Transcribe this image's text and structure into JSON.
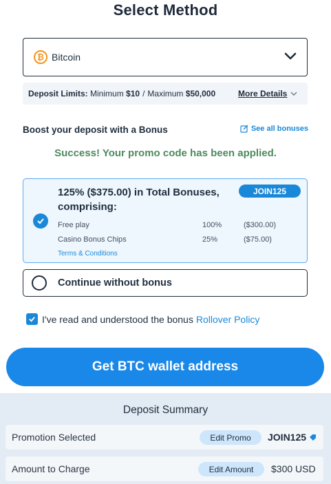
{
  "title": "Select Method",
  "method": {
    "selected": "Bitcoin",
    "icon": "bitcoin-icon",
    "icon_glyph": "₿"
  },
  "limits": {
    "label": "Deposit Limits:",
    "min_label": "Minimum",
    "min_value": "$10",
    "separator": "/",
    "max_label": "Maximum",
    "max_value": "$50,000",
    "more_details": "More Details"
  },
  "bonus": {
    "section_title": "Boost your deposit with a Bonus",
    "see_all": "See all bonuses",
    "success_message": "Success! Your promo code has been applied.",
    "card": {
      "headline": "125% ($375.00) in Total Bonuses, comprising:",
      "promo_code": "JOIN125",
      "rows": [
        {
          "name": "Free play",
          "percent": "100%",
          "amount": "($300.00)"
        },
        {
          "name": "Casino Bonus Chips",
          "percent": "25%",
          "amount": "($75.00)"
        }
      ],
      "terms": "Terms & Conditions"
    },
    "no_bonus_label": "Continue without bonus"
  },
  "acknowledge": {
    "text": "I've read and understood the bonus",
    "link": "Rollover Policy"
  },
  "cta": {
    "label": "Get BTC wallet address"
  },
  "summary": {
    "title": "Deposit Summary",
    "promotion": {
      "label": "Promotion Selected",
      "edit": "Edit Promo",
      "value": "JOIN125"
    },
    "amount": {
      "label": "Amount to Charge",
      "edit": "Edit Amount",
      "value": "$300 USD"
    }
  },
  "colors": {
    "accent": "#1a88e8",
    "success": "#4d8a5f",
    "bitcoin": "#f7931a",
    "dark": "#1e2a3a",
    "summary_bg": "#e3ebf4"
  }
}
